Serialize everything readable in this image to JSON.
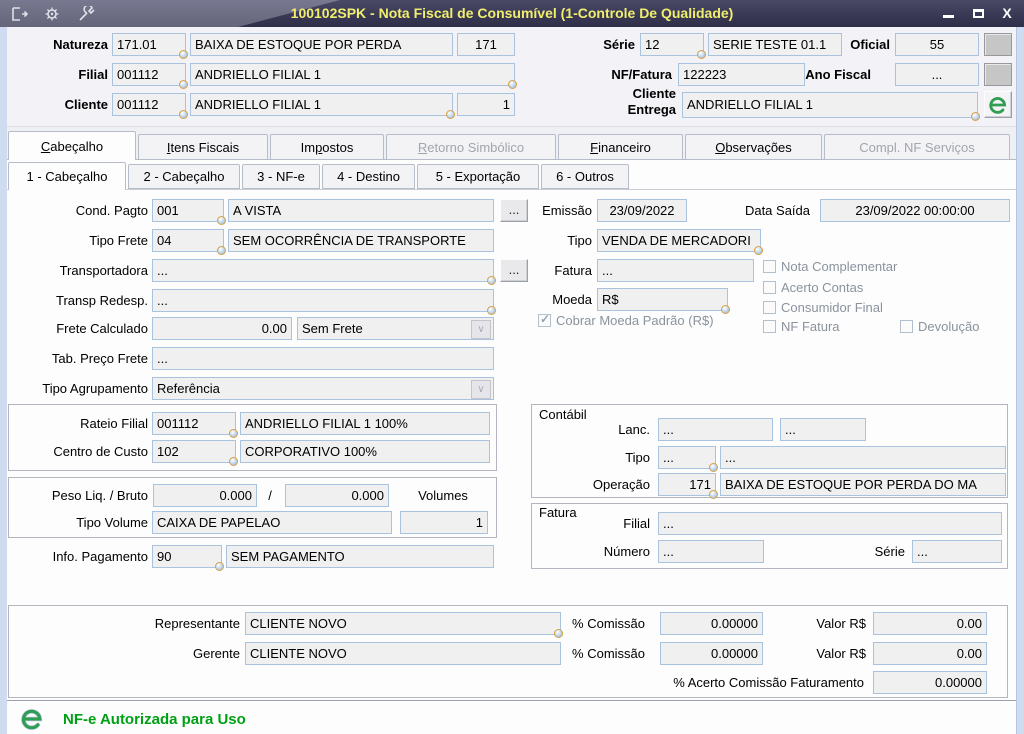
{
  "window": {
    "title": "100102SPK - Nota Fiscal de Consumível (1-Controle De Qualidade)",
    "close_label": "X",
    "toolbar_icons": [
      "exit-icon",
      "gear-icon",
      "wrench-icon"
    ],
    "colors": {
      "titlebar": "#3c3c58",
      "title_text": "#f0ee6e",
      "field_border": "#a9c2dd",
      "status_green": "#00a014"
    }
  },
  "header": {
    "natureza": {
      "label": "Natureza",
      "code": "171.01",
      "desc": "BAIXA DE ESTOQUE POR PERDA",
      "aux": "171"
    },
    "filial": {
      "label": "Filial",
      "code": "001112",
      "desc": "ANDRIELLO FILIAL 1"
    },
    "cliente": {
      "label": "Cliente",
      "code": "001112",
      "desc": "ANDRIELLO FILIAL 1",
      "aux": "1"
    },
    "serie": {
      "label": "Série",
      "code": "12",
      "desc": "SERIE TESTE 01.1"
    },
    "oficial": {
      "label": "Oficial",
      "value": "55"
    },
    "nf_fatura": {
      "label": "NF/Fatura",
      "value": "122223"
    },
    "ano_fiscal": {
      "label": "Ano Fiscal",
      "value": "..."
    },
    "cliente_entrega": {
      "label_line1": "Cliente",
      "label_line2": "Entrega",
      "value": "ANDRIELLO FILIAL 1"
    }
  },
  "tabs": {
    "main": [
      {
        "label": "Cabeçalho",
        "active": true
      },
      {
        "label": "Itens Fiscais"
      },
      {
        "label": "Impostos"
      },
      {
        "label": "Retorno Simbólico",
        "disabled": true
      },
      {
        "label": "Financeiro"
      },
      {
        "label": "Observações"
      },
      {
        "label": "Compl. NF Serviços",
        "disabled": true
      }
    ],
    "sub": [
      {
        "label": "1 - Cabeçalho",
        "active": true
      },
      {
        "label": "2 - Cabeçalho"
      },
      {
        "label": "3 - NF-e"
      },
      {
        "label": "4 - Destino"
      },
      {
        "label": "5 - Exportação"
      },
      {
        "label": "6 - Outros"
      }
    ]
  },
  "form": {
    "cond_pagto": {
      "label": "Cond. Pagto",
      "code": "001",
      "desc": "A VISTA",
      "browse": "..."
    },
    "tipo_frete": {
      "label": "Tipo Frete",
      "code": "04",
      "desc": "SEM OCORRÊNCIA DE TRANSPORTE"
    },
    "transportadora": {
      "label": "Transportadora",
      "value": "...",
      "browse": "..."
    },
    "transp_redesp": {
      "label": "Transp Redesp.",
      "value": "..."
    },
    "frete_calculado": {
      "label": "Frete Calculado",
      "value": "0.00",
      "tipo": "Sem Frete"
    },
    "tab_preco_frete": {
      "label": "Tab. Preço Frete",
      "value": "..."
    },
    "tipo_agrupamento": {
      "label": "Tipo Agrupamento",
      "value": "Referência"
    },
    "rateio_filial": {
      "label": "Rateio Filial",
      "code": "001112",
      "desc": "ANDRIELLO FILIAL 1 100%"
    },
    "centro_custo": {
      "label": "Centro de Custo",
      "code": "102",
      "desc": "CORPORATIVO 100%"
    },
    "peso": {
      "label": "Peso Liq. / Bruto",
      "liq": "0.000",
      "sep": "/",
      "bruto": "0.000",
      "volumes_label": "Volumes"
    },
    "tipo_volume": {
      "label": "Tipo Volume",
      "value": "CAIXA DE PAPELAO",
      "volumes": "1"
    },
    "info_pagamento": {
      "label": "Info. Pagamento",
      "code": "90",
      "desc": "SEM PAGAMENTO"
    },
    "emissao": {
      "label": "Emissão",
      "value": "23/09/2022"
    },
    "data_saida": {
      "label": "Data Saída",
      "value": "23/09/2022 00:00:00"
    },
    "tipo": {
      "label": "Tipo",
      "value": "VENDA DE MERCADORI"
    },
    "fatura": {
      "label": "Fatura",
      "value": "..."
    },
    "moeda": {
      "label": "Moeda",
      "value": "R$"
    },
    "cobrar_moeda": {
      "label": "Cobrar Moeda Padrão (R$)",
      "checked": true
    },
    "checkboxes": [
      {
        "label": "Nota Complementar",
        "checked": false
      },
      {
        "label": "Acerto Contas",
        "checked": false
      },
      {
        "label": "Consumidor Final",
        "checked": false
      },
      {
        "label": "NF Fatura",
        "checked": false
      },
      {
        "label": "Devolução",
        "checked": false
      }
    ],
    "contabil": {
      "legend": "Contábil",
      "lanc": {
        "label": "Lanc.",
        "v1": "...",
        "v2": "..."
      },
      "tipo": {
        "label": "Tipo",
        "code": "...",
        "desc": "..."
      },
      "operacao": {
        "label": "Operação",
        "code": "171",
        "desc": "BAIXA DE ESTOQUE POR PERDA DO MA"
      }
    },
    "fatura_group": {
      "legend": "Fatura",
      "filial": {
        "label": "Filial",
        "value": "..."
      },
      "numero": {
        "label": "Número",
        "value": "..."
      },
      "serie": {
        "label": "Série",
        "value": "..."
      }
    },
    "comissao": {
      "representante": {
        "label": "Representante",
        "value": "CLIENTE NOVO"
      },
      "gerente": {
        "label": "Gerente",
        "value": "CLIENTE NOVO"
      },
      "pct_label": "% Comissão",
      "valor_label": "Valor R$",
      "rep_pct": "0.00000",
      "rep_valor": "0.00",
      "ger_pct": "0.00000",
      "ger_valor": "0.00",
      "acerto_label": "% Acerto Comissão Faturamento",
      "acerto": "0.00000"
    }
  },
  "footer": {
    "status": "NF-e Autorizada para Uso"
  }
}
